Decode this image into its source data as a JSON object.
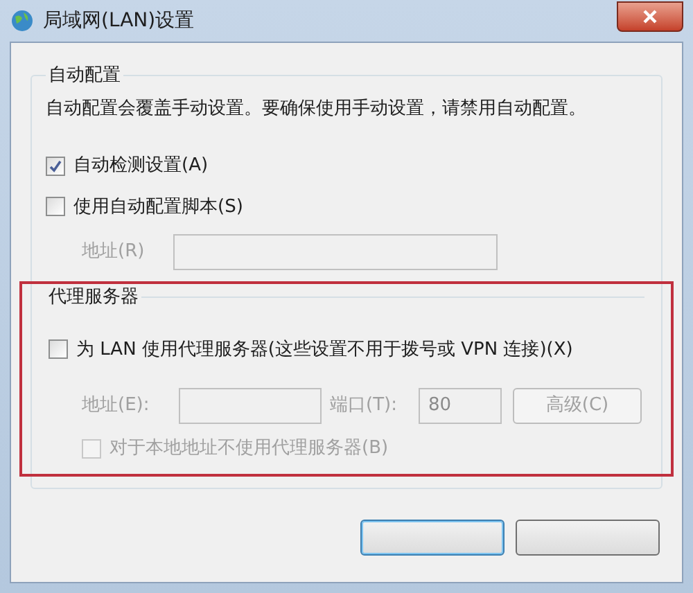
{
  "window": {
    "title": "局域网(LAN)设置"
  },
  "auto_config": {
    "title": "自动配置",
    "note": "自动配置会覆盖手动设置。要确保使用手动设置，请禁用自动配置。",
    "options": [
      {
        "label": "自动检测设置(A)",
        "checked": true,
        "disabled": false
      },
      {
        "label": "使用自动配置脚本(S)",
        "checked": false,
        "disabled": false
      }
    ],
    "address": {
      "label": "地址(R)",
      "disabled": true
    }
  },
  "proxy": {
    "title": "代理服务器",
    "highlighted": true,
    "use_proxy": {
      "label": "为 LAN 使用代理服务器(这些设置不用于拨号或 VPN 连接)(X)",
      "checked": false,
      "disabled": false
    },
    "address": {
      "label": "地址(E):",
      "disabled": true
    },
    "port": {
      "label": "端口(T):",
      "value": "80",
      "disabled": true
    },
    "advanced_button": {
      "label": "高级(C)",
      "disabled": true
    },
    "bypass_local": {
      "label": "对于本地地址不使用代理服务器(B)",
      "checked": false,
      "disabled": true
    }
  },
  "buttons": [
    {
      "kind": "default"
    },
    {
      "kind": "normal"
    }
  ]
}
